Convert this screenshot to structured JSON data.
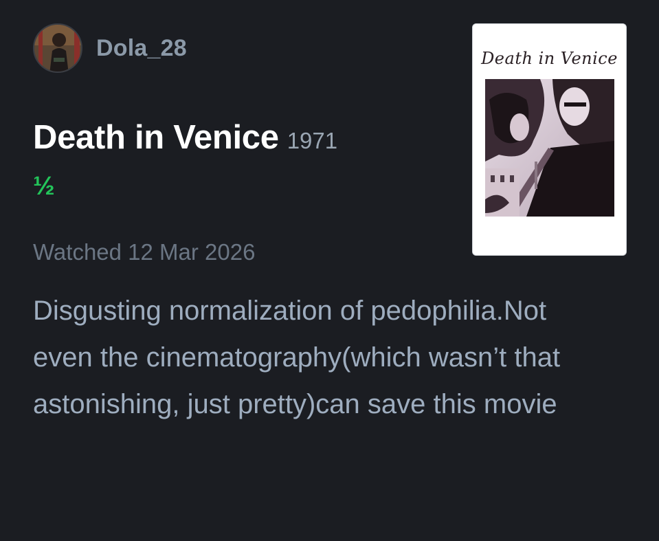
{
  "review": {
    "author": {
      "username": "Dola_28"
    },
    "film": {
      "title": "Death in Venice",
      "year": "1971",
      "poster_title": "Death in Venice"
    },
    "rating": {
      "display": "½",
      "stars": 0.5,
      "color": "#23c45a"
    },
    "watched_label": "Watched 12 Mar 2026",
    "body": "Disgusting normalization of pedophilia.Not even the cinematography(which wasn’t that astonishing, just pretty)can save this movie"
  },
  "theme": {
    "background": "#1b1d22",
    "title_color": "#ffffff",
    "text_color": "#9eadbf",
    "muted_color": "#6b7684",
    "username_color": "#8b99a8"
  }
}
